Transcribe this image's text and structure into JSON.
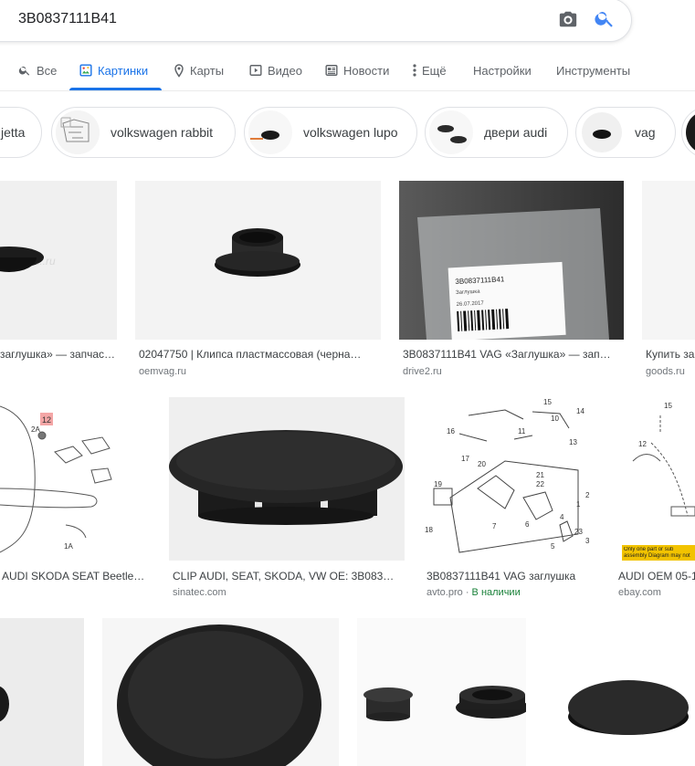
{
  "search": {
    "query": "3B0837111B41"
  },
  "tabs": [
    {
      "label": "Все",
      "icon": "search-icon"
    },
    {
      "label": "Картинки",
      "icon": "image-icon",
      "active": true
    },
    {
      "label": "Карты",
      "icon": "map-pin-icon"
    },
    {
      "label": "Видео",
      "icon": "video-icon"
    },
    {
      "label": "Новости",
      "icon": "news-icon"
    },
    {
      "label": "Ещё",
      "icon": "more-vert-icon"
    }
  ],
  "tools": {
    "settings": "Настройки",
    "instruments": "Инструменты"
  },
  "chips": [
    {
      "label": "jetta"
    },
    {
      "label": "volkswagen rabbit"
    },
    {
      "label": "volkswagen lupo"
    },
    {
      "label": "двери audi"
    },
    {
      "label": "vag"
    }
  ],
  "results": [
    {
      "caption": "заглушка» — запчаст…",
      "source": ""
    },
    {
      "caption": "02047750 | Клипса пластмассовая (черна…",
      "source": "oemvag.ru"
    },
    {
      "caption": "3B0837111B41 VAG «Заглушка» — зап…",
      "source": "drive2.ru"
    },
    {
      "caption": "Купить за",
      "source": "goods.ru"
    },
    {
      "caption": "AUDI SKODA SEAT Beetle…",
      "source": ""
    },
    {
      "caption": "CLIP AUDI, SEAT, SKODA, VW OE: 3B083…",
      "source": "sinatec.com"
    },
    {
      "caption": "3B0837111B41 VAG заглушка",
      "source": "avto.pro",
      "stock": "В наличии"
    },
    {
      "caption": "AUDI OEM 05-1",
      "source": "ebay.com"
    }
  ],
  "image_text": {
    "bag_label_part": "3B0837111B41",
    "bag_label_name": "Заглушка",
    "bag_label_date": "26.07.2017",
    "diagram_callouts": [
      "12",
      "2A",
      "1A",
      "15",
      "14",
      "13",
      "16",
      "11",
      "17",
      "19",
      "20",
      "21",
      "22",
      "18",
      "7",
      "6",
      "1",
      "23",
      "2",
      "3",
      "5",
      "4",
      "10"
    ],
    "ebay_note": "Only one part or sub assembly Diagram may not be specific to"
  },
  "colors": {
    "accent": "#1a73e8",
    "stock": "#188038",
    "muted": "#70757a"
  }
}
